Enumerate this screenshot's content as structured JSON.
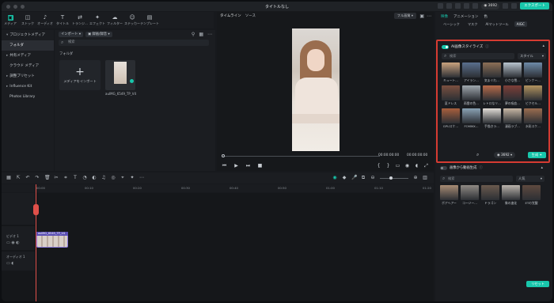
{
  "window": {
    "title": "タイトルなし"
  },
  "topbar": {
    "credits": "3692",
    "export_label": "エクスポート"
  },
  "toolbar": {
    "items": [
      {
        "label": "メディア",
        "icon": "media-icon"
      },
      {
        "label": "ストック",
        "icon": "stock-icon"
      },
      {
        "label": "オーディオ",
        "icon": "music-icon"
      },
      {
        "label": "タイトル",
        "icon": "text-icon"
      },
      {
        "label": "トランジ…",
        "icon": "transition-icon"
      },
      {
        "label": "エフェクト",
        "icon": "effect-icon"
      },
      {
        "label": "フィルター",
        "icon": "filter-icon"
      },
      {
        "label": "ステッカー",
        "icon": "sticker-icon"
      },
      {
        "label": "テンプレート",
        "icon": "template-icon"
      }
    ]
  },
  "sidebar": {
    "items": [
      {
        "label": "プロジェクトメディア"
      },
      {
        "label": "フォルダ"
      },
      {
        "label": "共有メディア"
      },
      {
        "label": "クラウド メディア"
      },
      {
        "label": "調整プリセット"
      },
      {
        "label": "Influence Kit"
      },
      {
        "label": "Photos Library"
      }
    ]
  },
  "media": {
    "import_label": "インポート",
    "sort_label": "録画/録音",
    "search_placeholder": "検索",
    "folder_label": "フォルダ",
    "import_tile_label": "メディアをインポート",
    "clip_name": "auIMG_6549_TP_V4"
  },
  "player": {
    "tabs": [
      "タイムライン",
      "ソース"
    ],
    "fit_label": "フル画質",
    "time_current": "00:00:00:00",
    "time_total": "00:00:00:00"
  },
  "props": {
    "tabs": [
      "映像",
      "アニメーション",
      "色"
    ],
    "subtabs": [
      "ベーシック",
      "マスク",
      "AIマットツール",
      "AIGC"
    ],
    "ai_style": {
      "title": "AI画像スタイライズ",
      "search_placeholder": "検索",
      "style_label": "スタイル",
      "items": [
        {
          "name": "キュート…",
          "color": "#c9a27e"
        },
        {
          "name": "アイラン…",
          "color": "#5a6f8e"
        },
        {
          "name": "気まぐれ…",
          "color": "#8d6f56"
        },
        {
          "name": "小さな雪…",
          "color": "#b8c4cf"
        },
        {
          "name": "ピンナー…",
          "color": "#6d8aa8"
        },
        {
          "name": "夏ドレス",
          "color": "#7b5040"
        },
        {
          "name": "雨雲の色…",
          "color": "#9fa7ae"
        },
        {
          "name": "レトロなリ…",
          "color": "#b86b4a"
        },
        {
          "name": "夢の吸血…",
          "color": "#7e3f38"
        },
        {
          "name": "ピクセル…",
          "color": "#b1935f"
        },
        {
          "name": "GPUスケ…",
          "color": "#a85f3d"
        },
        {
          "name": "FOMMX…",
          "color": "#8aa2b4"
        },
        {
          "name": "手描きラ…",
          "color": "#e0dcd6"
        },
        {
          "name": "漫画ラブ…",
          "color": "#c7b6a4"
        },
        {
          "name": "水彩スケ…",
          "color": "#9b6d50"
        }
      ],
      "credit": "3692",
      "generate_label": "生成"
    },
    "video_gen": {
      "title": "画像から動画生成",
      "search_placeholder": "検索",
      "popular_label": "人気",
      "items": [
        {
          "name": "ポアヘアー",
          "color": "#a88c74"
        },
        {
          "name": "コージー…",
          "color": "#8f8a84"
        },
        {
          "name": "ドラゴン",
          "color": "#6a5a4e"
        },
        {
          "name": "像の進化",
          "color": "#b9b2ab"
        },
        {
          "name": "ETの覚醒",
          "color": "#5e4a3f"
        }
      ]
    },
    "reset_label": "リセット"
  },
  "timeline": {
    "ruler_marks": [
      "00:00",
      "00:10",
      "00:20",
      "00:30",
      "00:40",
      "00:50",
      "01:00",
      "01:10",
      "01:20"
    ],
    "video_track_label": "ビデオ 1",
    "audio_track_label": "オーディオ 1",
    "clip_name": "auIMG_6549_TP_V4"
  }
}
